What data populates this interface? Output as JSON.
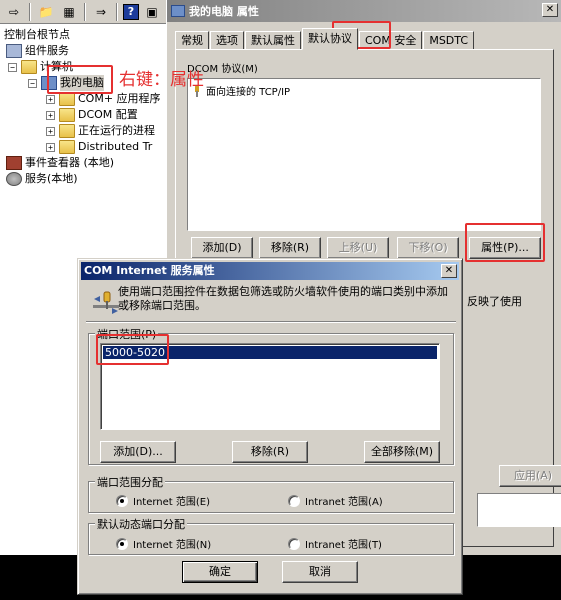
{
  "mmc": {
    "tree": {
      "root": "控制台根节点",
      "component_services": "组件服务",
      "computers": "计算机",
      "my_computer": "我的电脑",
      "children": [
        "COM+ 应用程序",
        "DCOM 配置",
        "正在运行的进程",
        "Distributed Tr"
      ],
      "event_viewer": "事件查看器 (本地)",
      "services": "服务(本地)"
    },
    "annotation": "右键：属性"
  },
  "prop_dialog": {
    "title": "我的电脑 属性",
    "close": "✕",
    "tabs": [
      "常规",
      "选项",
      "默认属性",
      "默认协议",
      "COM 安全",
      "MSDTC"
    ],
    "active_tab": "默认协议",
    "protocols_label": "DCOM 协议(M)",
    "protocols": [
      "面向连接的 TCP/IP"
    ],
    "buttons": {
      "add": "添加(D)",
      "remove": "移除(R)",
      "up": "上移(U)",
      "down": "下移(O)",
      "properties": "属性(P)..."
    },
    "partial_text": "反映了使用",
    "apply": "应用(A)"
  },
  "com_dialog": {
    "title": "COM Internet 服务属性",
    "close": "✕",
    "description": "使用端口范围控件在数据包筛选或防火墙软件使用的端口类别中添加或移除端口范围。",
    "port_ranges_label": "端口范围(P)",
    "port_ranges": [
      "5000-5020"
    ],
    "buttons": {
      "add": "添加(D)...",
      "remove": "移除(R)",
      "remove_all": "全部移除(M)",
      "ok": "确定",
      "cancel": "取消"
    },
    "assignment_group": {
      "label": "端口范围分配",
      "internet": "Internet 范围(E)",
      "intranet": "Intranet 范围(A)",
      "selected": "internet"
    },
    "default_group": {
      "label": "默认动态端口分配",
      "internet": "Internet 范围(N)",
      "intranet": "Intranet 范围(T)",
      "selected": "internet"
    }
  },
  "colors": {
    "annotation": "#e53030",
    "title_active": "#0a246a",
    "selection": "#0a246a",
    "face": "#d4d0c8"
  }
}
